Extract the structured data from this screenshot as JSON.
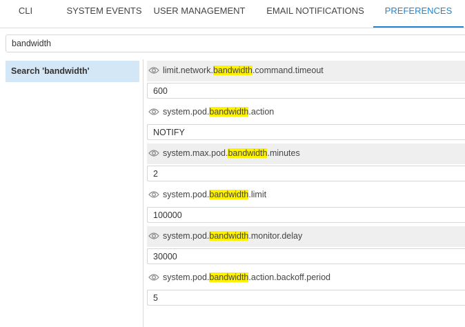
{
  "tabs": [
    {
      "label": "CLI",
      "active": false
    },
    {
      "label": "SYSTEM EVENTS",
      "active": false
    },
    {
      "label": "USER MANAGEMENT",
      "active": false
    },
    {
      "label": "EMAIL NOTIFICATIONS",
      "active": false
    },
    {
      "label": "PREFERENCES",
      "active": true
    }
  ],
  "search": {
    "value": "bandwidth"
  },
  "sidebar": {
    "items": [
      {
        "label": "Search 'bandwidth'",
        "selected": true
      }
    ]
  },
  "preferences": [
    {
      "key_prefix": "limit.network.",
      "key_match": "bandwidth",
      "key_suffix": ".command.timeout",
      "value": "600"
    },
    {
      "key_prefix": "system.pod.",
      "key_match": "bandwidth",
      "key_suffix": ".action",
      "value": "NOTIFY"
    },
    {
      "key_prefix": "system.max.pod.",
      "key_match": "bandwidth",
      "key_suffix": ".minutes",
      "value": "2"
    },
    {
      "key_prefix": "system.pod.",
      "key_match": "bandwidth",
      "key_suffix": ".limit",
      "value": "100000"
    },
    {
      "key_prefix": "system.pod.",
      "key_match": "bandwidth",
      "key_suffix": ".monitor.delay",
      "value": "30000"
    },
    {
      "key_prefix": "system.pod.",
      "key_match": "bandwidth",
      "key_suffix": ".action.backoff.period",
      "value": "5"
    }
  ],
  "colors": {
    "accent": "#1f86d1",
    "highlight": "#fff200",
    "sidebar_selected": "#d4e7f7",
    "row_shade": "#efefef"
  }
}
